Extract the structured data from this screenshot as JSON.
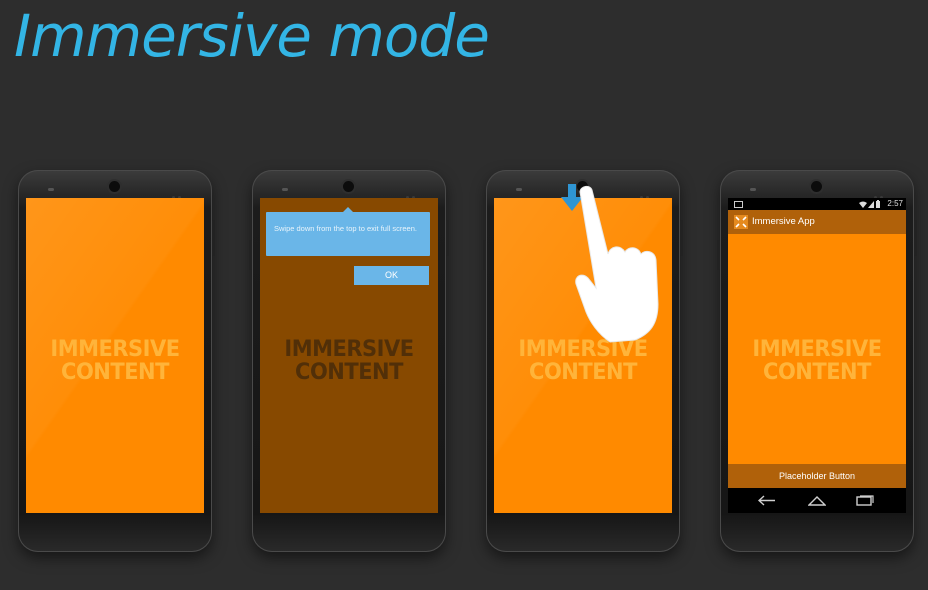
{
  "title": "Immersive mode",
  "immersive_content": {
    "line1": "IMMERSIVE",
    "line2": "CONTENT"
  },
  "phone2": {
    "tip_text": "Swipe down from the top to exit full screen.",
    "ok_label": "OK"
  },
  "phone4": {
    "time": "2:57",
    "app_title": "Immersive App",
    "placeholder_button": "Placeholder Button"
  },
  "colors": {
    "accent": "#33b5e5",
    "content_orange": "#ff8a00",
    "bar_brown": "#b0610a",
    "tooltip_blue": "#6ab6e8"
  },
  "icons": [
    "down-arrow-icon",
    "hand-swipe-icon",
    "notification-icon",
    "wifi-icon",
    "signal-icon",
    "battery-icon",
    "back-icon",
    "home-icon",
    "recents-icon"
  ]
}
